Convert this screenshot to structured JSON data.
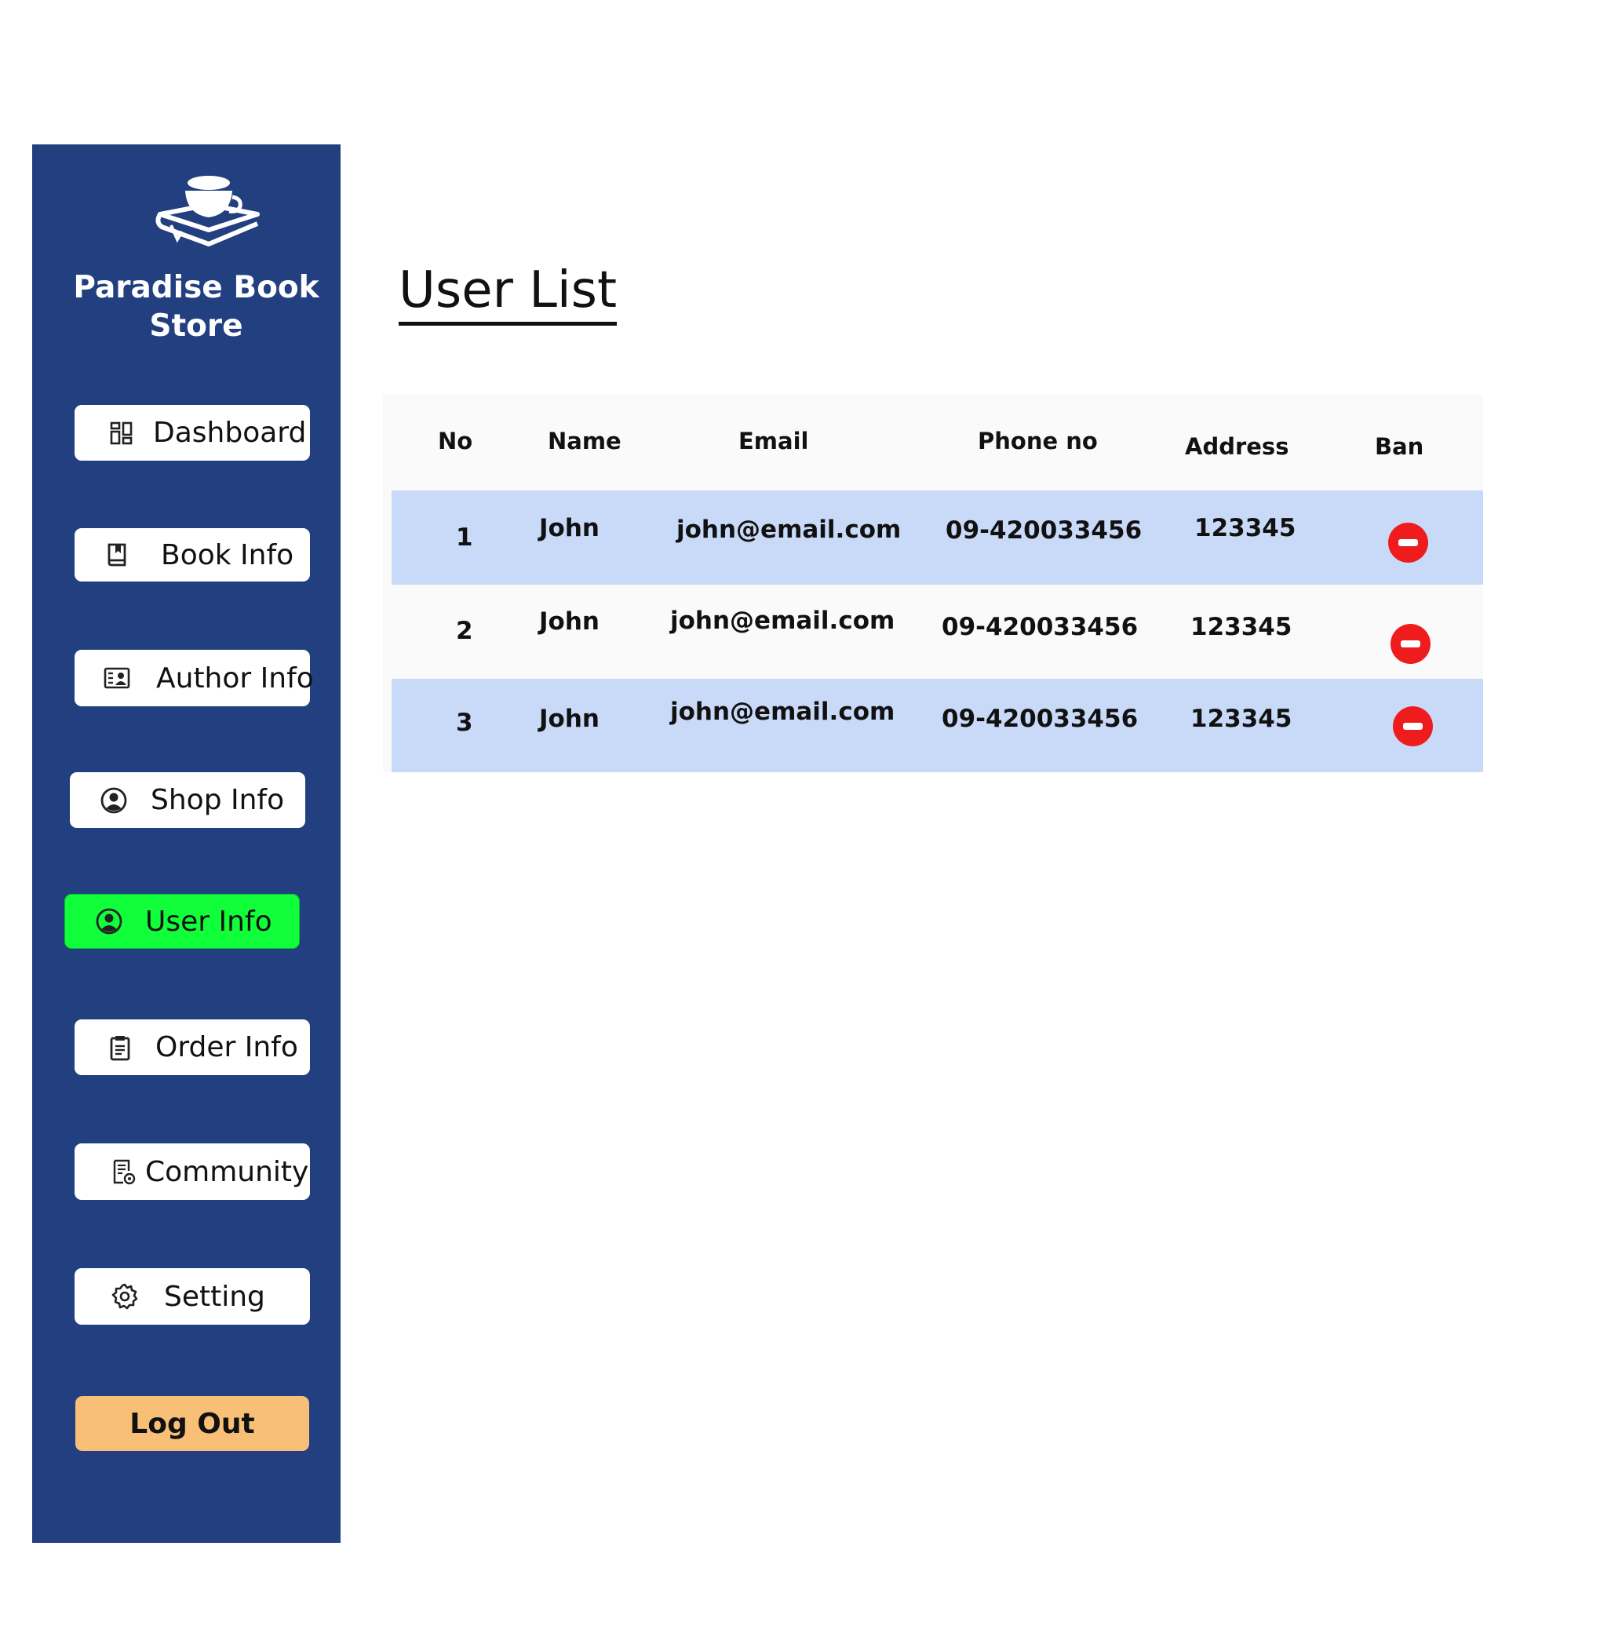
{
  "brand": {
    "name": "Paradise Book Store"
  },
  "sidebar": {
    "items": [
      {
        "label": "Dashboard",
        "icon": "dashboard-icon"
      },
      {
        "label": "Book Info",
        "icon": "book-icon"
      },
      {
        "label": "Author Info",
        "icon": "author-card-icon"
      },
      {
        "label": "Shop Info",
        "icon": "user-circle-icon"
      },
      {
        "label": "User Info",
        "icon": "user-circle-icon",
        "active": true
      },
      {
        "label": "Order Info",
        "icon": "clipboard-icon"
      },
      {
        "label": "Community",
        "icon": "community-doc-icon"
      },
      {
        "label": "Setting",
        "icon": "gear-icon"
      }
    ],
    "logout_label": "Log Out"
  },
  "main": {
    "title": "User List"
  },
  "table": {
    "columns": [
      "No",
      "Name",
      "Email",
      "Phone no",
      "Address",
      "Ban"
    ],
    "rows": [
      {
        "no": "1",
        "name": "John",
        "email": "john@email.com",
        "phone": "09-420033456",
        "address": "123345"
      },
      {
        "no": "2",
        "name": "John",
        "email": "john@email.com",
        "phone": "09-420033456",
        "address": "123345"
      },
      {
        "no": "3",
        "name": "John",
        "email": "john@email.com",
        "phone": "09-420033456",
        "address": "123345"
      }
    ]
  },
  "colors": {
    "sidebar_bg": "#223f80",
    "active_item": "#10ff3a",
    "logout_bg": "#f8bf76",
    "row_highlight": "#c9daf8",
    "ban_red": "#ee1c1c"
  }
}
